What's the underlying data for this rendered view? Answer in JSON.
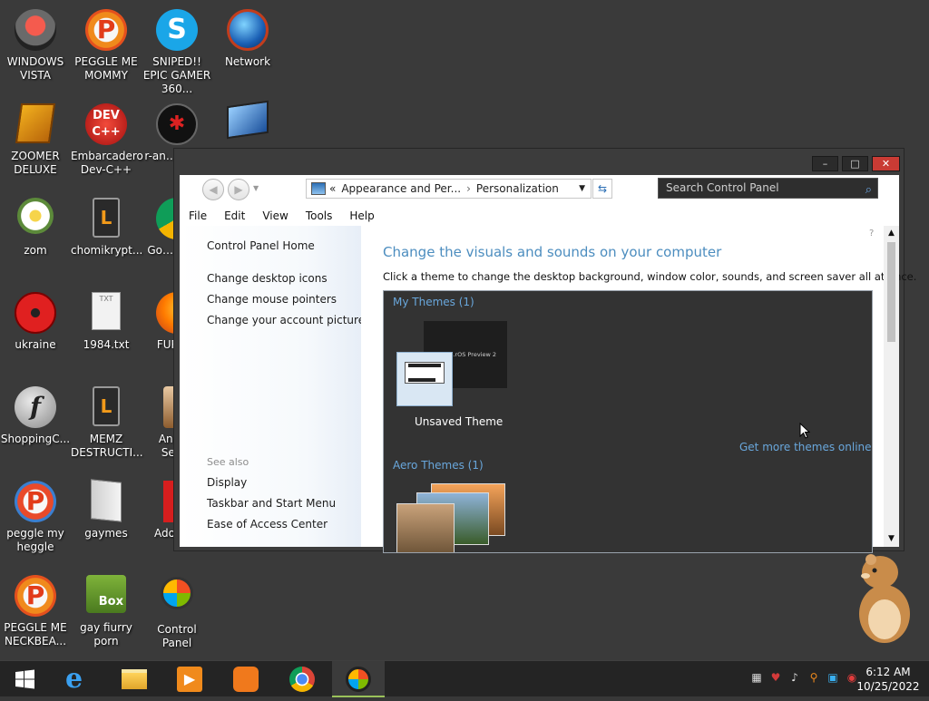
{
  "desktop": {
    "icons": [
      {
        "label": "WINDOWS VISTA",
        "icon": "vista-orb-icon"
      },
      {
        "label": "PEGGLE ME MOMMY",
        "icon": "peggle-icon"
      },
      {
        "label": "SNIPED!! EPIC GAMER 360...",
        "icon": "skype-icon"
      },
      {
        "label": "Network",
        "icon": "network-globe-icon"
      },
      {
        "label": "ZOOMER DELUXE",
        "icon": "zoomer-icon"
      },
      {
        "label": "Embarcadero Dev-C++",
        "icon": "devcpp-icon"
      },
      {
        "label": "r-an… par…",
        "icon": "spider-icon"
      },
      {
        "label": "zom",
        "icon": "flower-icon"
      },
      {
        "label": "chomikrypt...",
        "icon": "clock-app-icon"
      },
      {
        "label": "Go… Chr…",
        "icon": "chrome-icon"
      },
      {
        "label": "ukraine",
        "icon": "radiation-icon"
      },
      {
        "label": "1984.txt",
        "icon": "text-file-icon"
      },
      {
        "label": "FURR…",
        "icon": "firefox-icon"
      },
      {
        "label": "ShoppingC...",
        "icon": "flash-icon"
      },
      {
        "label": "MEMZ DESTRUCTI...",
        "icon": "clock-app-icon"
      },
      {
        "label": "Angr… Sea…",
        "icon": "angry-birds-icon"
      },
      {
        "label": "peggle my heggle",
        "icon": "peggle-icon"
      },
      {
        "label": "gaymes",
        "icon": "folder-icon"
      },
      {
        "label": "Adobe…",
        "icon": "adobe-icon"
      },
      {
        "label": "PEGGLE ME NECKBEA...",
        "icon": "peggle-icon"
      },
      {
        "label": "gay fiurry porn",
        "icon": "box-hamster-icon"
      },
      {
        "label": "Control Panel",
        "icon": "control-panel-icon"
      }
    ]
  },
  "window": {
    "caption_buttons": {
      "minimize": "–",
      "maximize": "□",
      "close": "✕"
    },
    "address": {
      "prefix": "«",
      "crumb1": "Appearance and Per...",
      "sep": "›",
      "crumb2": "Personalization",
      "dropdown": "▼"
    },
    "search": {
      "placeholder": "Search Control Panel"
    },
    "menu": [
      "File",
      "Edit",
      "View",
      "Tools",
      "Help"
    ],
    "left_pane": {
      "home": "Control Panel Home",
      "tasks": [
        "Change desktop icons",
        "Change mouse pointers",
        "Change your account picture"
      ],
      "see_also_label": "See also",
      "see_also": [
        "Display",
        "Taskbar and Start Menu",
        "Ease of Access Center"
      ]
    },
    "main": {
      "heading": "Change the visuals and sounds on your computer",
      "description": "Click a theme to change the desktop background, window color, sounds, and screen saver all at once.",
      "my_themes_label": "My Themes (1)",
      "thumb_caption": "…rOS Preview 2",
      "unsaved_theme": "Unsaved Theme",
      "get_more": "Get more themes online",
      "aero_themes_label": "Aero Themes (1)"
    }
  },
  "taskbar": {
    "apps": [
      "start-icon",
      "internet-explorer-icon",
      "file-explorer-icon",
      "media-player-icon",
      "uc-browser-icon",
      "chrome-icon",
      "control-panel-icon"
    ],
    "clock_time": "6:12 AM",
    "clock_date": "10/25/2022"
  },
  "colors": {
    "desktop": "#3a3a3a",
    "taskbar": "#242424",
    "link_blue": "#4c8dbf",
    "close_red": "#c93b34"
  }
}
